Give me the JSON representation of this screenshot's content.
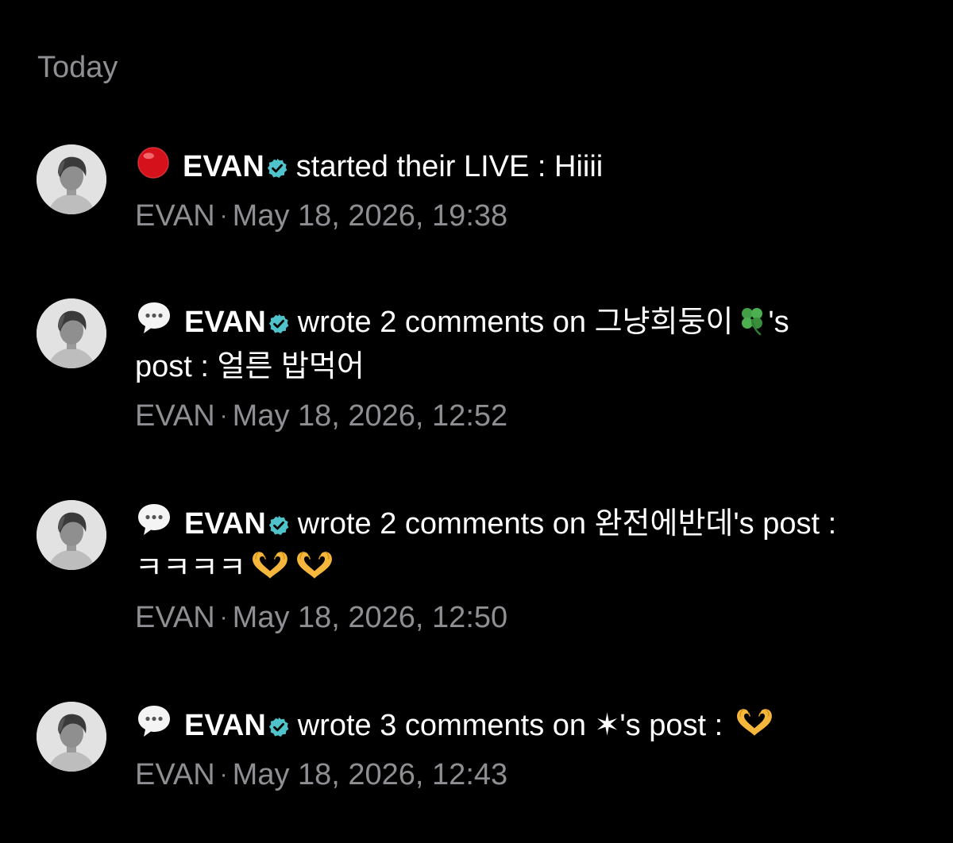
{
  "section_title": "Today",
  "notifications": [
    {
      "type_icon": "red-circle-icon",
      "username": "EVAN",
      "action": "started their LIVE : Hiiii",
      "line2": "",
      "emojis": [],
      "meta_user": "EVAN",
      "meta_separator": "·",
      "timestamp": "May 18, 2026, 19:38"
    },
    {
      "type_icon": "speech-bubble-icon",
      "username": "EVAN",
      "action": "wrote 2 comments on 그냥희둥이",
      "action_suffix": "'s",
      "line2": "post : 얼른 밥먹어",
      "emojis": [
        "four-leaf-clover-icon"
      ],
      "meta_user": "EVAN",
      "meta_separator": "·",
      "timestamp": "May 18, 2026, 12:52"
    },
    {
      "type_icon": "speech-bubble-icon",
      "username": "EVAN",
      "action": "wrote 2 comments on 완전에반데's post :",
      "line2": "ㅋㅋㅋㅋ",
      "emojis": [
        "heart-hands-icon",
        "heart-hands-icon"
      ],
      "meta_user": "EVAN",
      "meta_separator": "·",
      "timestamp": "May 18, 2026, 12:50"
    },
    {
      "type_icon": "speech-bubble-icon",
      "username": "EVAN",
      "action": "wrote 3 comments on ✶'s post :",
      "line2": "",
      "emojis": [
        "heart-hands-icon"
      ],
      "meta_user": "EVAN",
      "meta_separator": "·",
      "timestamp": "May 18, 2026, 12:43"
    }
  ],
  "colors": {
    "background": "#000000",
    "text": "#ffffff",
    "secondary": "#8e8e93",
    "verified": "#4fc3c9",
    "live_red": "#e0131c"
  }
}
